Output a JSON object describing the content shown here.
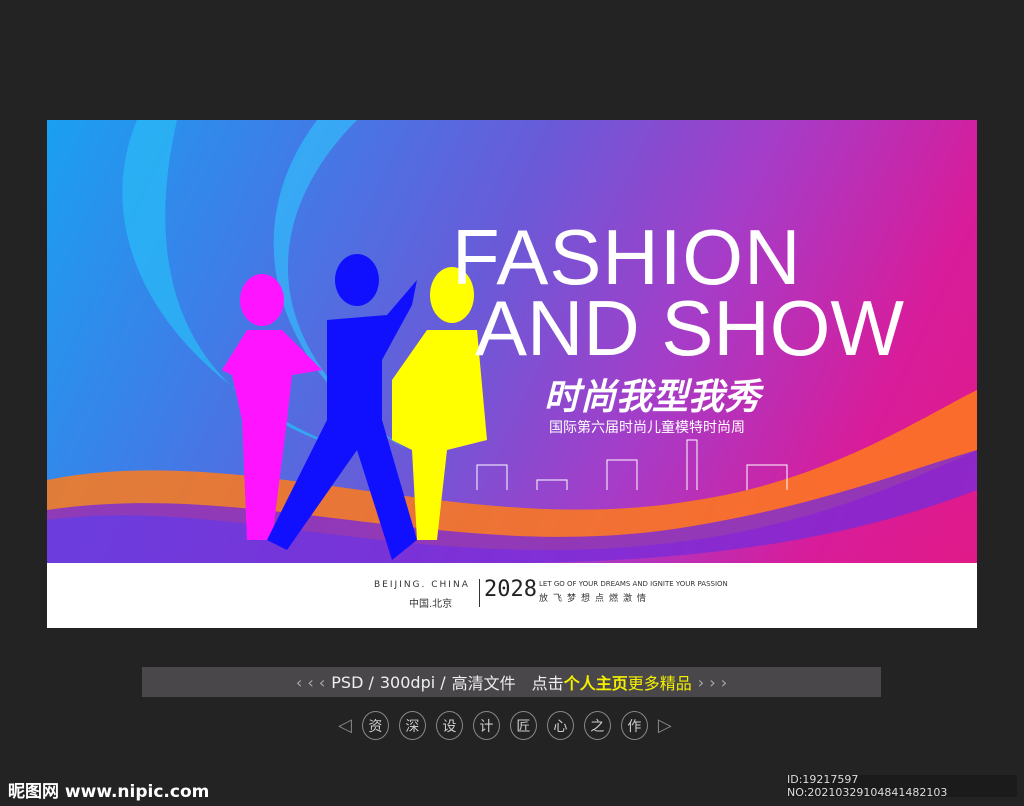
{
  "poster": {
    "title_line1": "FASHION",
    "title_line2": "AND SHOW",
    "slogan": "时尚我型我秀",
    "subtitle": "国际第六届时尚儿童模特时尚周",
    "location_en": "BEIJING. CHINA",
    "location_cn": "中国.北京",
    "year": "2028",
    "tagline_en": "LET GO OF YOUR DREAMS AND IGNITE YOUR PASSION",
    "tagline_cn": "放飞梦想点燃激情"
  },
  "info_bar": {
    "left_chevrons": "‹ ‹ ‹",
    "format": "PSD /",
    "dpi": "300dpi /",
    "quality": "高清文件",
    "click": "点击",
    "highlight": "个人主页",
    "more": "更多精品",
    "right_chevrons": "› › ›"
  },
  "motto": [
    "资",
    "深",
    "设",
    "计",
    "匠",
    "心",
    "之",
    "作"
  ],
  "watermark": {
    "logo": "昵图网 www.nipic.com",
    "id": "ID:19217597 NO:20210329104841482103"
  },
  "colors": {
    "highlight": "#f5f000",
    "bg": "#232323"
  }
}
